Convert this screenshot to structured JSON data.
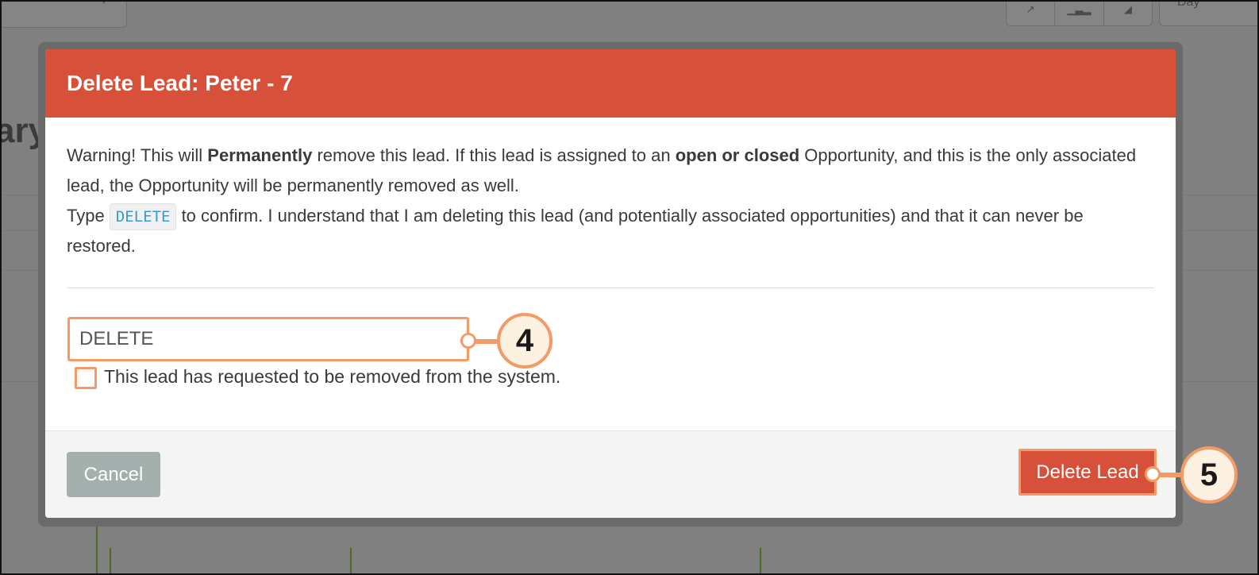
{
  "background": {
    "heading_fragment": "ary",
    "day_selector": "Day",
    "chart_type_icons": [
      "line-chart-icon",
      "bar-chart-icon",
      "area-chart-icon"
    ],
    "bar_color": "#4e6a22"
  },
  "modal": {
    "title": "Delete Lead: Peter - 7",
    "header_color": "#d6503a",
    "warning": {
      "prefix": "Warning! This will ",
      "emphasis1": "Permanently",
      "middle": " remove this lead. If this lead is assigned to an ",
      "emphasis2": "open or closed",
      "suffix": " Opportunity, and this is the only associated lead, the Opportunity will be permanently removed as well."
    },
    "confirm_text": {
      "prefix": "Type ",
      "code": "DELETE",
      "suffix": " to confirm. I understand that I am deleting this lead (and potentially associated opportunities) and that it can never be restored."
    },
    "confirm_input_value": "DELETE",
    "checkbox_label": "This lead has requested to be removed from the system.",
    "checkbox_checked": false,
    "cancel_label": "Cancel",
    "delete_label": "Delete Lead"
  },
  "callouts": {
    "input_step": "4",
    "delete_step": "5",
    "highlight_color": "#f39a66"
  }
}
